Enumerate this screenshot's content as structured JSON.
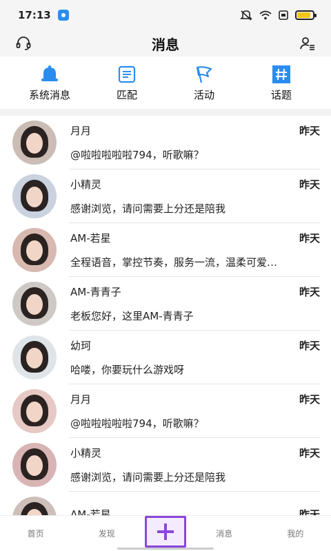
{
  "status": {
    "time": "17:13",
    "battery_level": 0.85,
    "icons": [
      "app-notification-icon",
      "mute-icon",
      "wifi-icon",
      "sim-icon",
      "battery-icon"
    ]
  },
  "header": {
    "title": "消息",
    "left_icon": "headset-icon",
    "right_icon": "user-list-icon"
  },
  "tabs": [
    {
      "label": "系统消息",
      "icon": "bell-icon"
    },
    {
      "label": "匹配",
      "icon": "list-icon"
    },
    {
      "label": "活动",
      "icon": "flag-icon"
    },
    {
      "label": "话题",
      "icon": "hashtag-icon"
    }
  ],
  "messages": [
    {
      "name": "月月",
      "time": "昨天",
      "text": "@啦啦啦啦啦794，听歌嘛？",
      "avatar_bg": "#cbbdb5"
    },
    {
      "name": "小精灵",
      "time": "昨天",
      "text": "感谢浏览，请问需要上分还是陪我",
      "avatar_bg": "#c9d2de"
    },
    {
      "name": "AM-若星",
      "time": "昨天",
      "text": "全程语音，掌控节奏，服务一流，温柔可爱…",
      "avatar_bg": "#d8b9b0"
    },
    {
      "name": "AM-青青子",
      "time": "昨天",
      "text": "老板您好，这里AM-青青子",
      "avatar_bg": "#cfc9c6"
    },
    {
      "name": "幼珂",
      "time": "昨天",
      "text": "哈喽，你要玩什么游戏呀",
      "avatar_bg": "#dfe4e8"
    },
    {
      "name": "月月",
      "time": "昨天",
      "text": "@啦啦啦啦啦794，听歌嘛？",
      "avatar_bg": "#e6c9c4"
    },
    {
      "name": "小精灵",
      "time": "昨天",
      "text": "感谢浏览，请问需要上分还是陪我",
      "avatar_bg": "#d9b4b4"
    },
    {
      "name": "AM-若星",
      "time": "昨天",
      "text": "",
      "avatar_bg": "#cdbfba"
    }
  ],
  "bottom_nav": {
    "home": "首页",
    "discover": "发现",
    "messages": "消息",
    "mine": "我的",
    "center_icon": "plus-icon"
  },
  "colors": {
    "accent": "#2b8cf0",
    "center_button": "#8a46d8"
  }
}
